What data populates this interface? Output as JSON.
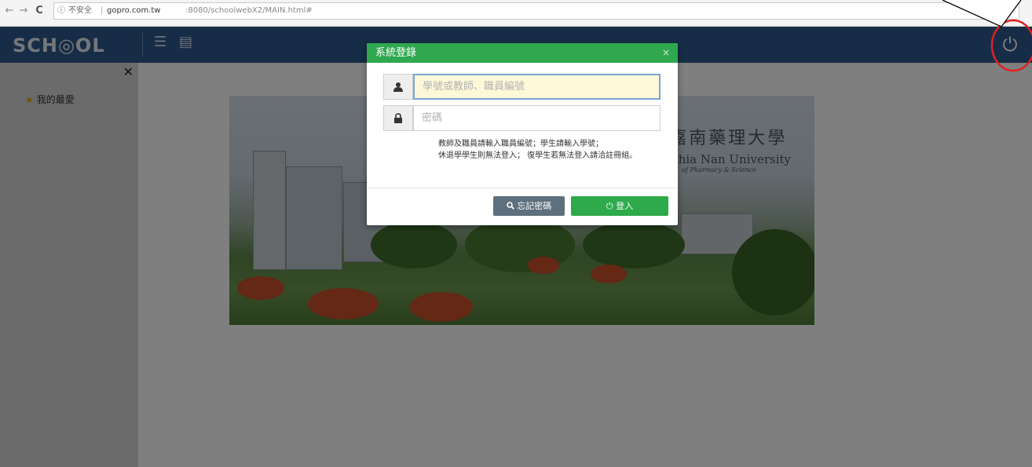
{
  "browser": {
    "back_icon": "←",
    "forward_icon": "→",
    "reload_icon": "C",
    "info_icon": "ⓘ",
    "security_text": "不安全",
    "separator": "|",
    "url_host": "gopro.com.tw",
    "url_path": ":8080/schoolwebX2/MAIN.html#"
  },
  "header": {
    "logo_text": "SCH◎OL",
    "menu_icon": "☰",
    "card_icon": "▤",
    "power_icon": "⏻"
  },
  "sidebar": {
    "close_icon": "✕",
    "favorites_label": "我的最愛",
    "star_icon": "★"
  },
  "banner": {
    "university_cn": "嘉南藥理大學",
    "university_en": "Chia Nan University",
    "university_sub": "of Pharmacy & Science"
  },
  "login_modal": {
    "title": "系統登錄",
    "close_icon": "×",
    "user_icon": "👤",
    "lock_icon": "🔒",
    "username_placeholder": "學號或教師、職員編號",
    "password_placeholder": "密碼",
    "hint_line1": "教師及職員請輸入職員編號；學生請輸入學號；",
    "hint_line2": "休退學學生則無法登入； 復學生若無法登入請洽註冊組。",
    "forgot_label": "忘記密碼",
    "forgot_icon": "🔍",
    "login_label": "登入",
    "login_icon": "⏻"
  },
  "colors": {
    "header_bg": "#2f5a8f",
    "modal_header": "#2fa84f",
    "login_button": "#2eaa4a",
    "forgot_button": "#5e6f7d",
    "annotation": "#e02020"
  }
}
